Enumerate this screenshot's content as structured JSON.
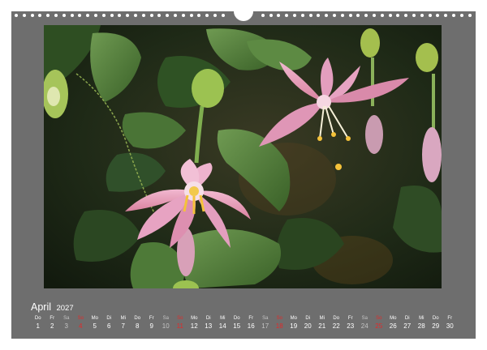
{
  "calendar": {
    "month": "April",
    "year": "2027",
    "days": [
      {
        "wd": "Do",
        "n": "1",
        "kind": "weekday"
      },
      {
        "wd": "Fr",
        "n": "2",
        "kind": "weekday"
      },
      {
        "wd": "Sa",
        "n": "3",
        "kind": "sat"
      },
      {
        "wd": "So",
        "n": "4",
        "kind": "sun"
      },
      {
        "wd": "Mo",
        "n": "5",
        "kind": "weekday"
      },
      {
        "wd": "Di",
        "n": "6",
        "kind": "weekday"
      },
      {
        "wd": "Mi",
        "n": "7",
        "kind": "weekday"
      },
      {
        "wd": "Do",
        "n": "8",
        "kind": "weekday"
      },
      {
        "wd": "Fr",
        "n": "9",
        "kind": "weekday"
      },
      {
        "wd": "Sa",
        "n": "10",
        "kind": "sat"
      },
      {
        "wd": "So",
        "n": "11",
        "kind": "sun"
      },
      {
        "wd": "Mo",
        "n": "12",
        "kind": "weekday"
      },
      {
        "wd": "Di",
        "n": "13",
        "kind": "weekday"
      },
      {
        "wd": "Mi",
        "n": "14",
        "kind": "weekday"
      },
      {
        "wd": "Do",
        "n": "15",
        "kind": "weekday"
      },
      {
        "wd": "Fr",
        "n": "16",
        "kind": "weekday"
      },
      {
        "wd": "Sa",
        "n": "17",
        "kind": "sat"
      },
      {
        "wd": "So",
        "n": "18",
        "kind": "sun"
      },
      {
        "wd": "Mo",
        "n": "19",
        "kind": "weekday"
      },
      {
        "wd": "Di",
        "n": "20",
        "kind": "weekday"
      },
      {
        "wd": "Mi",
        "n": "21",
        "kind": "weekday"
      },
      {
        "wd": "Do",
        "n": "22",
        "kind": "weekday"
      },
      {
        "wd": "Fr",
        "n": "23",
        "kind": "weekday"
      },
      {
        "wd": "Sa",
        "n": "24",
        "kind": "sat"
      },
      {
        "wd": "So",
        "n": "25",
        "kind": "sun"
      },
      {
        "wd": "Mo",
        "n": "26",
        "kind": "weekday"
      },
      {
        "wd": "Di",
        "n": "27",
        "kind": "weekday"
      },
      {
        "wd": "Mi",
        "n": "28",
        "kind": "weekday"
      },
      {
        "wd": "Do",
        "n": "29",
        "kind": "weekday"
      },
      {
        "wd": "Fr",
        "n": "30",
        "kind": "weekday"
      }
    ]
  },
  "photo": {
    "subject": "passion-flower",
    "signature": "",
    "colors": {
      "page": "#6e6e6e",
      "sunday": "#e22a2a",
      "saturday": "#c4c4c4",
      "petal": "#e49cbc",
      "leaf": "#4d7a3a"
    }
  }
}
